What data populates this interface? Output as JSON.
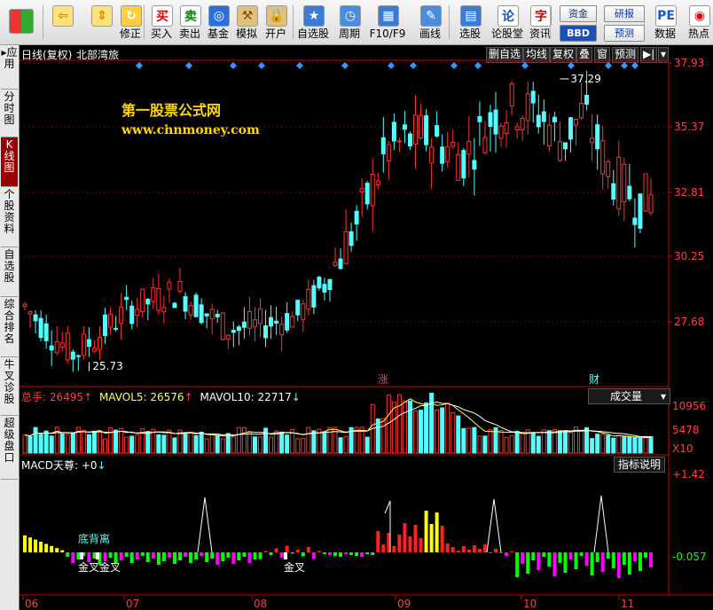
{
  "toolbar": {
    "buttons": [
      {
        "label": "",
        "icon": "home-grid-icon"
      },
      {
        "label": "",
        "icon": "back-arrow-icon"
      },
      {
        "label": "",
        "icon": "up-down-arrows-icon"
      },
      {
        "label": "修正",
        "icon": "refresh-icon"
      },
      {
        "label": "买入",
        "icon": "buy-icon"
      },
      {
        "label": "卖出",
        "icon": "sell-icon"
      },
      {
        "label": "基金",
        "icon": "fund-icon"
      },
      {
        "label": "模拟",
        "icon": "hammer-icon"
      },
      {
        "label": "开户",
        "icon": "lock-icon"
      },
      {
        "label": "自选股",
        "icon": "star-icon"
      },
      {
        "label": "周期",
        "icon": "clock-icon"
      },
      {
        "label": "F10/F9",
        "icon": "f10-icon"
      },
      {
        "label": "画线",
        "icon": "pencil-icon"
      },
      {
        "label": "选股",
        "icon": "screen-icon"
      },
      {
        "label": "论股堂",
        "icon": "forum-icon"
      },
      {
        "label": "资讯",
        "icon": "news-icon"
      },
      {
        "label": "数据",
        "icon": "pe-icon"
      },
      {
        "label": "热点",
        "icon": "hotspot-icon"
      }
    ],
    "small": {
      "capital": "资金",
      "bbd": "BBD",
      "research": "研报",
      "forecast": "预测"
    },
    "glyphs": {
      "buy": "买",
      "sell": "卖",
      "forum": "论",
      "news": "字",
      "pe": "PE"
    }
  },
  "sidebar": {
    "items": [
      {
        "label": "▸应用"
      },
      {
        "label": "分时图"
      },
      {
        "label": "K线图"
      },
      {
        "label": "个股资料"
      },
      {
        "label": "自选股"
      },
      {
        "label": "综合排名"
      },
      {
        "label": "牛叉诊股"
      },
      {
        "label": "超级盘口"
      }
    ]
  },
  "chart": {
    "period_label": "日线(复权)",
    "stock_name": "北部湾旅",
    "menu": [
      "删自选",
      "均线",
      "复权",
      "叠",
      "窗",
      "预测"
    ],
    "watermark_title": "第一股票公式网",
    "watermark_url": "www.chnmoney.com",
    "price_axis": [
      "37.93",
      "35.37",
      "32.81",
      "30.25",
      "27.68"
    ],
    "high_marker": "37.29",
    "low_marker": "25.73",
    "event_zhang": "涨",
    "event_cai": "财",
    "volume": {
      "total_label": "总手:",
      "total_value": "26495",
      "mavol5_label": "MAVOL5:",
      "mavol5_value": "26576",
      "mavol10_label": "MAVOL10:",
      "mavol10_value": "22717",
      "dropdown": "成交量",
      "axis": [
        "10956",
        "5478",
        "X10"
      ]
    },
    "macd": {
      "label": "MACD天尊:",
      "value": "+0",
      "help_button": "指标说明",
      "axis_top": "+1.42",
      "axis_bottom": "-0.057",
      "annot_bottom_divergence": "底背离",
      "annot_golden_cross": "金叉",
      "annot_golden_cross2": "金叉金叉"
    },
    "x_axis": [
      "06",
      "07",
      "08",
      "09",
      "10",
      "11"
    ],
    "colors": {
      "up": "#ff3232",
      "down": "#54ffff",
      "axis": "#c00000",
      "macd_red": "#ff2020",
      "macd_yellow": "#ffff00",
      "macd_green": "#00ff00",
      "macd_magenta": "#ff00ff"
    }
  }
}
